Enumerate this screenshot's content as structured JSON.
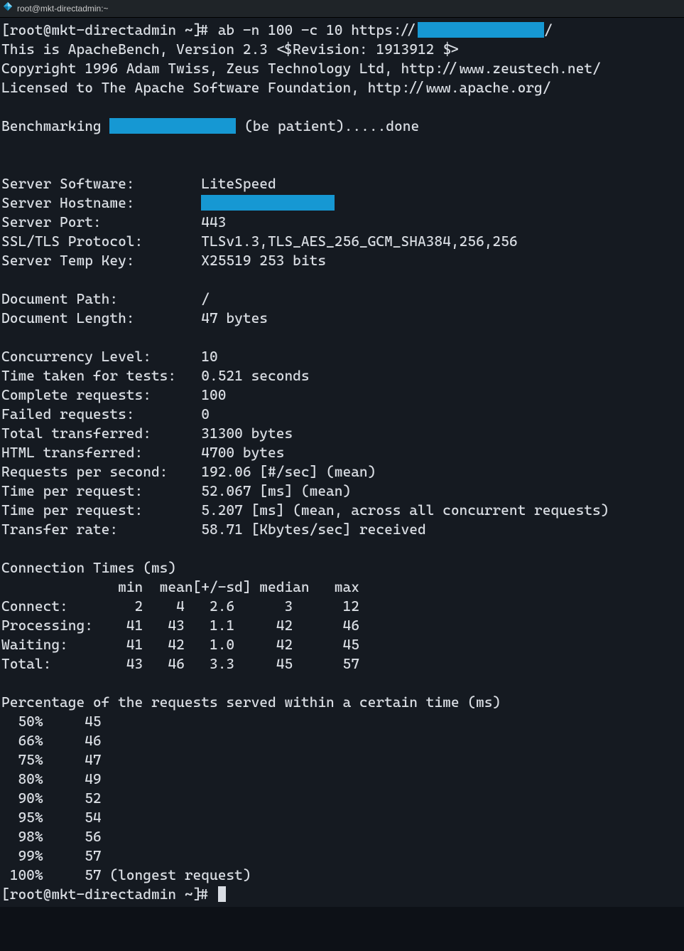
{
  "window": {
    "title": "root@mkt-directadmin:~"
  },
  "prompt": {
    "full": "[root@mkt-directadmin ~]# ",
    "cmd_before_url": "ab -n 100 -c 10 https://",
    "cmd_after_url": "/"
  },
  "header": {
    "l1": "This is ApacheBench, Version 2.3 <$Revision: 1913912 $>",
    "l2": "Copyright 1996 Adam Twiss, Zeus Technology Ltd, http://www.zeustech.net/",
    "l3": "Licensed to The Apache Software Foundation, http://www.apache.org/"
  },
  "bench": {
    "pre": "Benchmarking ",
    "post": " (be patient).....done"
  },
  "kv": {
    "ss": "Server Software:        LiteSpeed",
    "sh": "Server Hostname:        ",
    "sp": "Server Port:            443",
    "ssl": "SSL/TLS Protocol:       TLSv1.3,TLS_AES_256_GCM_SHA384,256,256",
    "stk": "Server Temp Key:        X25519 253 bits",
    "dp": "Document Path:          /",
    "dl": "Document Length:        47 bytes",
    "cl": "Concurrency Level:      10",
    "tt": "Time taken for tests:   0.521 seconds",
    "cr": "Complete requests:      100",
    "fr": "Failed requests:        0",
    "tx": "Total transferred:      31300 bytes",
    "ht": "HTML transferred:       4700 bytes",
    "rps": "Requests per second:    192.06 [#/sec] (mean)",
    "tpr1": "Time per request:       52.067 [ms] (mean)",
    "tpr2": "Time per request:       5.207 [ms] (mean, across all concurrent requests)",
    "tr": "Transfer rate:          58.71 [Kbytes/sec] received"
  },
  "ct": {
    "title": "Connection Times (ms)",
    "head": "              min  mean[+/-sd] median   max",
    "row1": "Connect:        2    4   2.6      3      12",
    "row2": "Processing:    41   43   1.1     42      46",
    "row3": "Waiting:       41   42   1.0     42      45",
    "row4": "Total:         43   46   3.3     45      57"
  },
  "pct": {
    "title": "Percentage of the requests served within a certain time (ms)",
    "r50": "  50%     45",
    "r66": "  66%     46",
    "r75": "  75%     47",
    "r80": "  80%     49",
    "r90": "  90%     52",
    "r95": "  95%     54",
    "r98": "  98%     56",
    "r99": "  99%     57",
    "r100": " 100%     57 (longest request)"
  },
  "end_prompt": "[root@mkt-directadmin ~]# "
}
